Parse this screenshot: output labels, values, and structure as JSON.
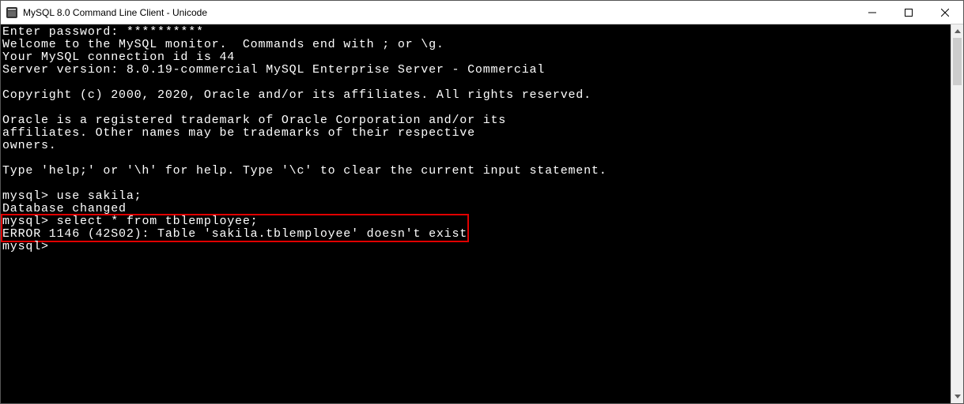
{
  "window": {
    "title": "MySQL 8.0 Command Line Client - Unicode"
  },
  "terminal": {
    "line1": "Enter password: **********",
    "line2": "Welcome to the MySQL monitor.  Commands end with ; or \\g.",
    "line3": "Your MySQL connection id is 44",
    "line4": "Server version: 8.0.19-commercial MySQL Enterprise Server - Commercial",
    "line5": "",
    "line6": "Copyright (c) 2000, 2020, Oracle and/or its affiliates. All rights reserved.",
    "line7": "",
    "line8": "Oracle is a registered trademark of Oracle Corporation and/or its",
    "line9": "affiliates. Other names may be trademarks of their respective",
    "line10": "owners.",
    "line11": "",
    "line12": "Type 'help;' or '\\h' for help. Type '\\c' to clear the current input statement.",
    "line13": "",
    "prompt1": "mysql> ",
    "cmd1": "use sakila;",
    "resp1": "Database changed",
    "prompt2a": "mysql> ",
    "cmd2a": "select * from tblemployee;",
    "error_line": "ERROR 1146 (42S02): Table 'sakila.tblemployee' doesn't exist",
    "prompt3": "mysql>"
  }
}
